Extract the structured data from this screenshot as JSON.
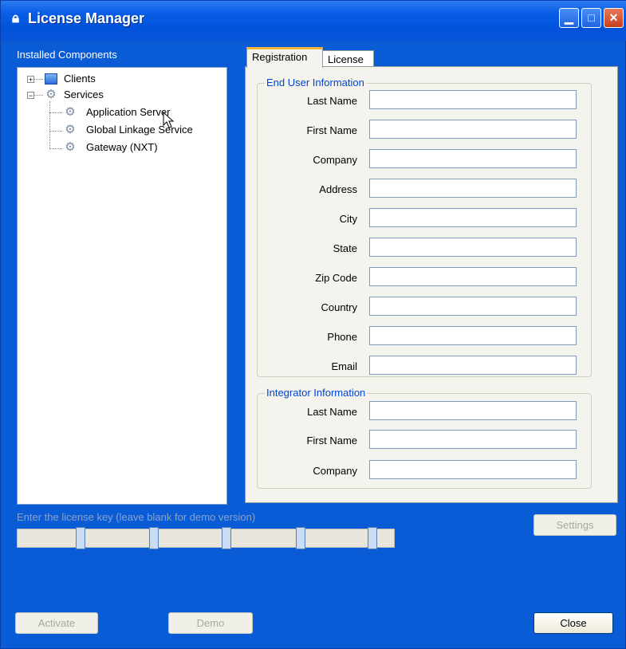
{
  "window": {
    "title": "License Manager",
    "title_icon": "lock-icon"
  },
  "left": {
    "installed_label": "Installed Components",
    "tree": [
      {
        "label": "Clients",
        "expander": "+",
        "icon": "client-window-icon"
      },
      {
        "label": "Services",
        "expander": "−",
        "icon": "gear-icon"
      },
      {
        "label": "Application Server",
        "icon": "gear-icon"
      },
      {
        "label": "Global Linkage Service",
        "icon": "gear-icon"
      },
      {
        "label": "Gateway (NXT)",
        "icon": "gear-icon"
      }
    ]
  },
  "tabs": [
    {
      "label": "Registration",
      "active": true
    },
    {
      "label": "License",
      "active": false
    }
  ],
  "end_user": {
    "title": "End User Information",
    "fields": [
      {
        "label": "Last Name",
        "value": ""
      },
      {
        "label": "First Name",
        "value": ""
      },
      {
        "label": "Company",
        "value": ""
      },
      {
        "label": "Address",
        "value": ""
      },
      {
        "label": "City",
        "value": ""
      },
      {
        "label": "State",
        "value": ""
      },
      {
        "label": "Zip Code",
        "value": ""
      },
      {
        "label": "Country",
        "value": ""
      },
      {
        "label": "Phone",
        "value": ""
      },
      {
        "label": "Email",
        "value": ""
      }
    ]
  },
  "integrator": {
    "title": "Integrator Information",
    "fields": [
      {
        "label": "Last Name",
        "value": ""
      },
      {
        "label": "First Name",
        "value": ""
      },
      {
        "label": "Company",
        "value": ""
      }
    ]
  },
  "buttons": {
    "settings": "Settings",
    "activate": "Activate",
    "demo": "Demo",
    "close": "Close"
  },
  "license_key": {
    "label": "Enter the  license key (leave blank for demo version)"
  },
  "colors": {
    "window_bg": "#0a5bd6",
    "group_title": "#0046d5",
    "tab_accent": "#f5b53a"
  }
}
